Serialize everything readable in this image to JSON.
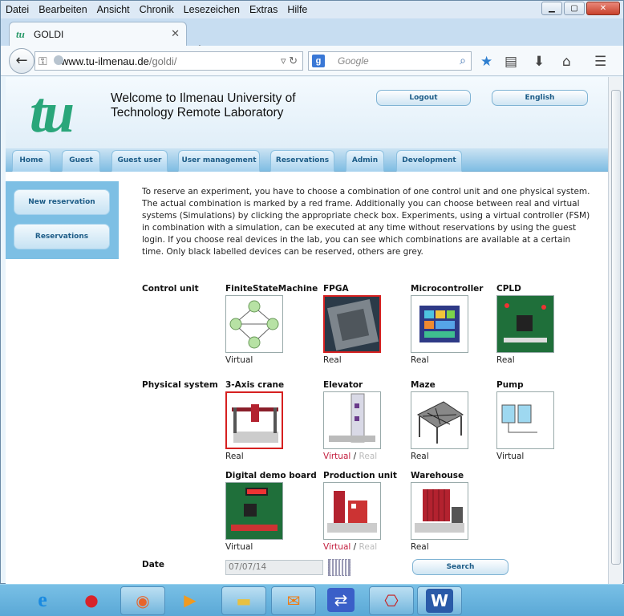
{
  "menu": [
    "Datei",
    "Bearbeiten",
    "Ansicht",
    "Chronik",
    "Lesezeichen",
    "Extras",
    "Hilfe"
  ],
  "browser": {
    "tab_title": "GOLDI",
    "url_domain": "www.tu-ilmenau.de",
    "url_path": "/goldi/",
    "search_placeholder": "Google"
  },
  "header": {
    "logo_text": "tu",
    "welcome_line1": "Welcome to Ilmenau University of",
    "welcome_line2": "Technology Remote Laboratory",
    "logout_label": "Logout",
    "language_label": "English"
  },
  "nav_tabs": [
    "Home",
    "Guest",
    "Guest user",
    "User management",
    "Reservations",
    "Admin",
    "Development"
  ],
  "sidebar": [
    "New reservation",
    "Reservations"
  ],
  "intro_text": "To reserve an experiment, you have to choose a combination of one control unit and one physical system. The actual combination is marked by a red frame. Additionally you can choose between real and virtual systems (Simulations) by clicking the appropriate check box. Experiments, using a virtual controller (FSM) in combination with a simulation, can be executed at any time without reservations by using the guest login. If you choose real devices in the lab, you can see which combinations are available at a certain time. Only black labelled devices can be reserved, others are grey.",
  "control_unit": {
    "label": "Control unit",
    "items": [
      {
        "name": "FiniteStateMachine",
        "status": "Virtual"
      },
      {
        "name": "FPGA",
        "status": "Real"
      },
      {
        "name": "Microcontroller",
        "status": "Real"
      },
      {
        "name": "CPLD",
        "status": "Real"
      }
    ]
  },
  "physical_system": {
    "label": "Physical system",
    "items": [
      {
        "name": "3-Axis crane",
        "status": "Real"
      },
      {
        "name": "Elevator",
        "virtual": "Virtual",
        "sep": "/",
        "real": "Real"
      },
      {
        "name": "Maze",
        "status": "Real"
      },
      {
        "name": "Pump",
        "status": "Virtual"
      },
      {
        "name": "Digital demo board",
        "status": "Virtual"
      },
      {
        "name": "Production unit",
        "virtual": "Virtual",
        "sep": "/",
        "real": "Real"
      },
      {
        "name": "Warehouse",
        "status": "Real"
      }
    ]
  },
  "date": {
    "label": "Date",
    "value": "07/07/14"
  },
  "search_label": "Search"
}
